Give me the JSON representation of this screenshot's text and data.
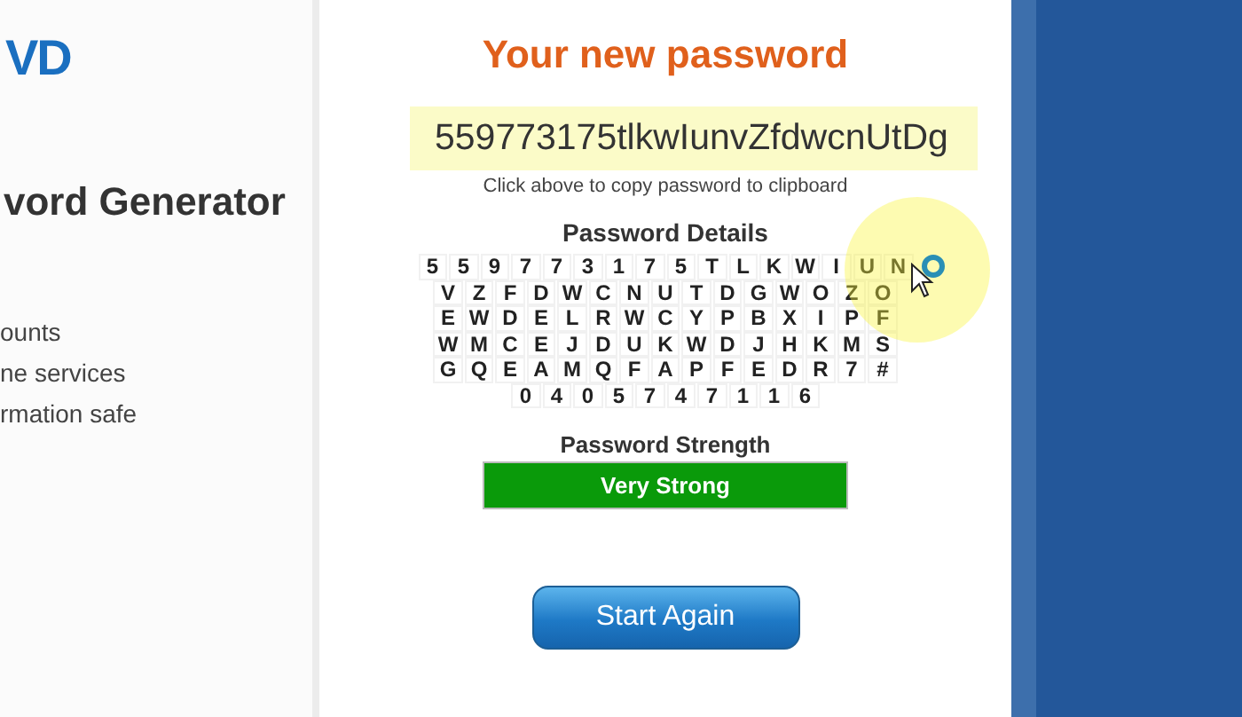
{
  "sidebar": {
    "logo": "VD",
    "heading": "vord Generator",
    "lines": [
      "ounts",
      "ne services",
      "rmation safe"
    ]
  },
  "main": {
    "title": "Your new password",
    "password": "559773175tlkwIunvZfdwcnUtDg",
    "hint": "Click above to copy password to clipboard",
    "details_heading": "Password Details",
    "details_rows": [
      [
        "5",
        "5",
        "9",
        "7",
        "7",
        "3",
        "1",
        "7",
        "5",
        "T",
        "L",
        "K",
        "W",
        "I",
        "U",
        "N"
      ],
      [
        "V",
        "Z",
        "F",
        "D",
        "W",
        "C",
        "N",
        "U",
        "T",
        "D",
        "G",
        "W",
        "O",
        "Z",
        "O"
      ],
      [
        "E",
        "W",
        "D",
        "E",
        "L",
        "R",
        "W",
        "C",
        "Y",
        "P",
        "B",
        "X",
        "I",
        "P",
        "F"
      ],
      [
        "W",
        "M",
        "C",
        "E",
        "J",
        "D",
        "U",
        "K",
        "W",
        "D",
        "J",
        "H",
        "K",
        "M",
        "S"
      ],
      [
        "G",
        "Q",
        "E",
        "A",
        "M",
        "Q",
        "F",
        "A",
        "P",
        "F",
        "E",
        "D",
        "R",
        "7",
        "#"
      ],
      [
        "0",
        "4",
        "0",
        "5",
        "7",
        "4",
        "7",
        "1",
        "1",
        "6"
      ]
    ],
    "strength_heading": "Password Strength",
    "strength": "Very Strong",
    "button": "Start Again"
  }
}
